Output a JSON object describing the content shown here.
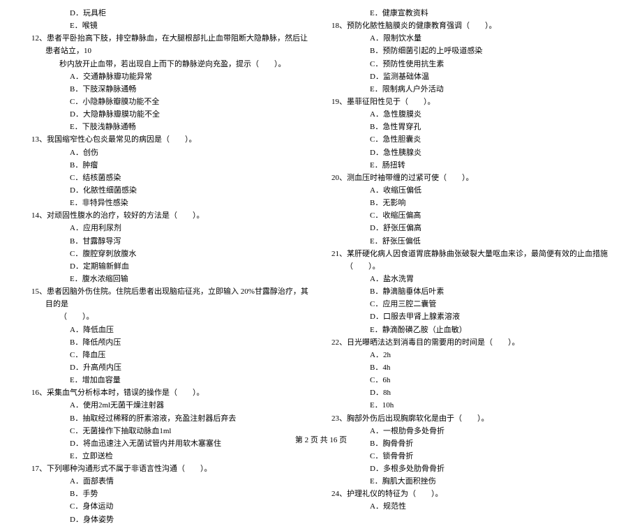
{
  "left": {
    "pre_options": [
      "D．玩具柜",
      "E．喉镜"
    ],
    "q12": "12、患者平卧抬高下肢，排空静脉血，在大腿根部扎止血带阻断大隐静脉，然后让患者站立，10",
    "q12b": "秒内放开止血带，若出现自上而下的静脉逆向充盈，提示（　　）。",
    "q12_opts": [
      "A．交通静脉瓣功能异常",
      "B．下肢深静脉通畅",
      "C．小隐静脉瓣膜功能不全",
      "D．大隐静脉瓣膜功能不全",
      "E．下肢浅静脉通畅"
    ],
    "q13": "13、我国缩窄性心包炎最常见的病因是（　　）。",
    "q13_opts": [
      "A．创伤",
      "B．肿瘤",
      "C．结核菌感染",
      "D．化脓性细菌感染",
      "E．非特异性感染"
    ],
    "q14": "14、对顽固性腹水的治疗，较好的方法是（　　）。",
    "q14_opts": [
      "A．应用利尿剂",
      "B．甘露醇导泻",
      "C．腹腔穿刺放腹水",
      "D．定期输新鲜血",
      "E．腹水浓缩回输"
    ],
    "q15": "15、患者因脑外伤住院。住院后患者出现脑疝征兆，立即输入 20%甘露醇治疗，其目的是",
    "q15b": "（　　）。",
    "q15_opts": [
      "A．降低血压",
      "B．降低颅内压",
      "C．降血压",
      "D．升高颅内压",
      "E．增加血容量"
    ],
    "q16": "16、采集血气分析标本时，错误的操作是（　　）。",
    "q16_opts": [
      "A．使用2ml无菌干燥注射器",
      "B．抽取经过稀释的肝素溶液，充盈注射器后弃去",
      "C．无菌操作下抽取动脉血1ml",
      "D．将血迅速注入无菌试管内并用软木塞塞住",
      "E．立即送检"
    ],
    "q17": "17、下列哪种沟通形式不属于非语言性沟通（　　）。",
    "q17_opts": [
      "A．面部表情",
      "B．手势",
      "C．身体运动",
      "D．身体姿势"
    ]
  },
  "right": {
    "pre_options": [
      "E．健康宣教资料"
    ],
    "q18": "18、预防化脓性脑膜炎的健康教育强调（　　）。",
    "q18_opts": [
      "A．限制饮水量",
      "B．预防细菌引起的上呼吸道感染",
      "C．预防性使用抗生素",
      "D．监测基础体温",
      "E．限制病人户外活动"
    ],
    "q19": "19、墨菲征阳性见于（　　）。",
    "q19_opts": [
      "A．急性腹膜炎",
      "B．急性胃穿孔",
      "C．急性胆囊炎",
      "D．急性胰腺炎",
      "E．肠扭转"
    ],
    "q20": "20、测血压时袖带缠的过紧可使（　　）。",
    "q20_opts": [
      "A．收缩压偏低",
      "B．无影响",
      "C．收缩压偏高",
      "D．舒张压偏高",
      "E．舒张压偏低"
    ],
    "q21": "21、某肝硬化病人因食道胃底静脉曲张破裂大量呕血来诊，最简便有效的止血措施（　　）。",
    "q21_opts": [
      "A．盐水洗胃",
      "B．静滴脑垂体后叶素",
      "C．应用三腔二囊管",
      "D．口服去甲肾上腺素溶液",
      "E．静滴酚磺乙胺（止血敏）"
    ],
    "q22": "22、日光曝晒法达到消毒目的需要用的时间是（　　）。",
    "q22_opts": [
      "A．2h",
      "B．4h",
      "C．6h",
      "D．8h",
      "E．10h"
    ],
    "q23": "23、胸部外伤后出现胸廓软化是由于（　　）。",
    "q23_opts": [
      "A．一根肋骨多处骨折",
      "B．胸骨骨折",
      "C．锁骨骨折",
      "D．多根多处肋骨骨折",
      "E．胸肌大面积挫伤"
    ],
    "q24": "24、护理礼仪的特征为（　　）。",
    "q24_opts": [
      "A．规范性"
    ]
  },
  "footer": "第 2 页 共 16 页"
}
